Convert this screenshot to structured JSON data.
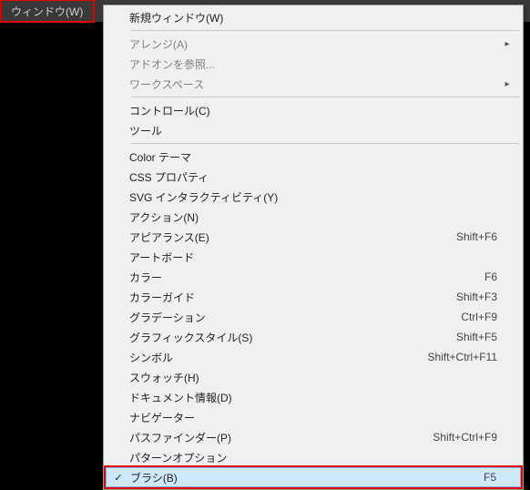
{
  "menubar": {
    "window_label": "ウィンドウ(W)"
  },
  "menu": {
    "items": [
      {
        "label": "新規ウィンドウ(W)"
      },
      {
        "sep": true
      },
      {
        "label": "アレンジ(A)",
        "disabled": true,
        "submenu": true
      },
      {
        "label": "アドオンを参照...",
        "disabled": true
      },
      {
        "label": "ワークスペース",
        "disabled": true,
        "submenu": true
      },
      {
        "sep": true
      },
      {
        "label": "コントロール(C)"
      },
      {
        "label": "ツール"
      },
      {
        "sep": true
      },
      {
        "label": "Color テーマ"
      },
      {
        "label": "CSS プロパティ"
      },
      {
        "label": "SVG インタラクティビティ(Y)"
      },
      {
        "label": "アクション(N)"
      },
      {
        "label": "アピアランス(E)",
        "shortcut": "Shift+F6"
      },
      {
        "label": "アートボード"
      },
      {
        "label": "カラー",
        "shortcut": "F6"
      },
      {
        "label": "カラーガイド",
        "shortcut": "Shift+F3"
      },
      {
        "label": "グラデーション",
        "shortcut": "Ctrl+F9"
      },
      {
        "label": "グラフィックスタイル(S)",
        "shortcut": "Shift+F5"
      },
      {
        "label": "シンボル",
        "shortcut": "Shift+Ctrl+F11"
      },
      {
        "label": "スウォッチ(H)"
      },
      {
        "label": "ドキュメント情報(D)"
      },
      {
        "label": "ナビゲーター"
      },
      {
        "label": "パスファインダー(P)",
        "shortcut": "Shift+Ctrl+F9"
      },
      {
        "label": "パターンオプション"
      },
      {
        "label": "ブラシ(B)",
        "shortcut": "F5",
        "checked": true,
        "highlighted": true,
        "hlbox": true
      }
    ]
  },
  "glyphs": {
    "check": "✓",
    "arrow": "▸"
  }
}
